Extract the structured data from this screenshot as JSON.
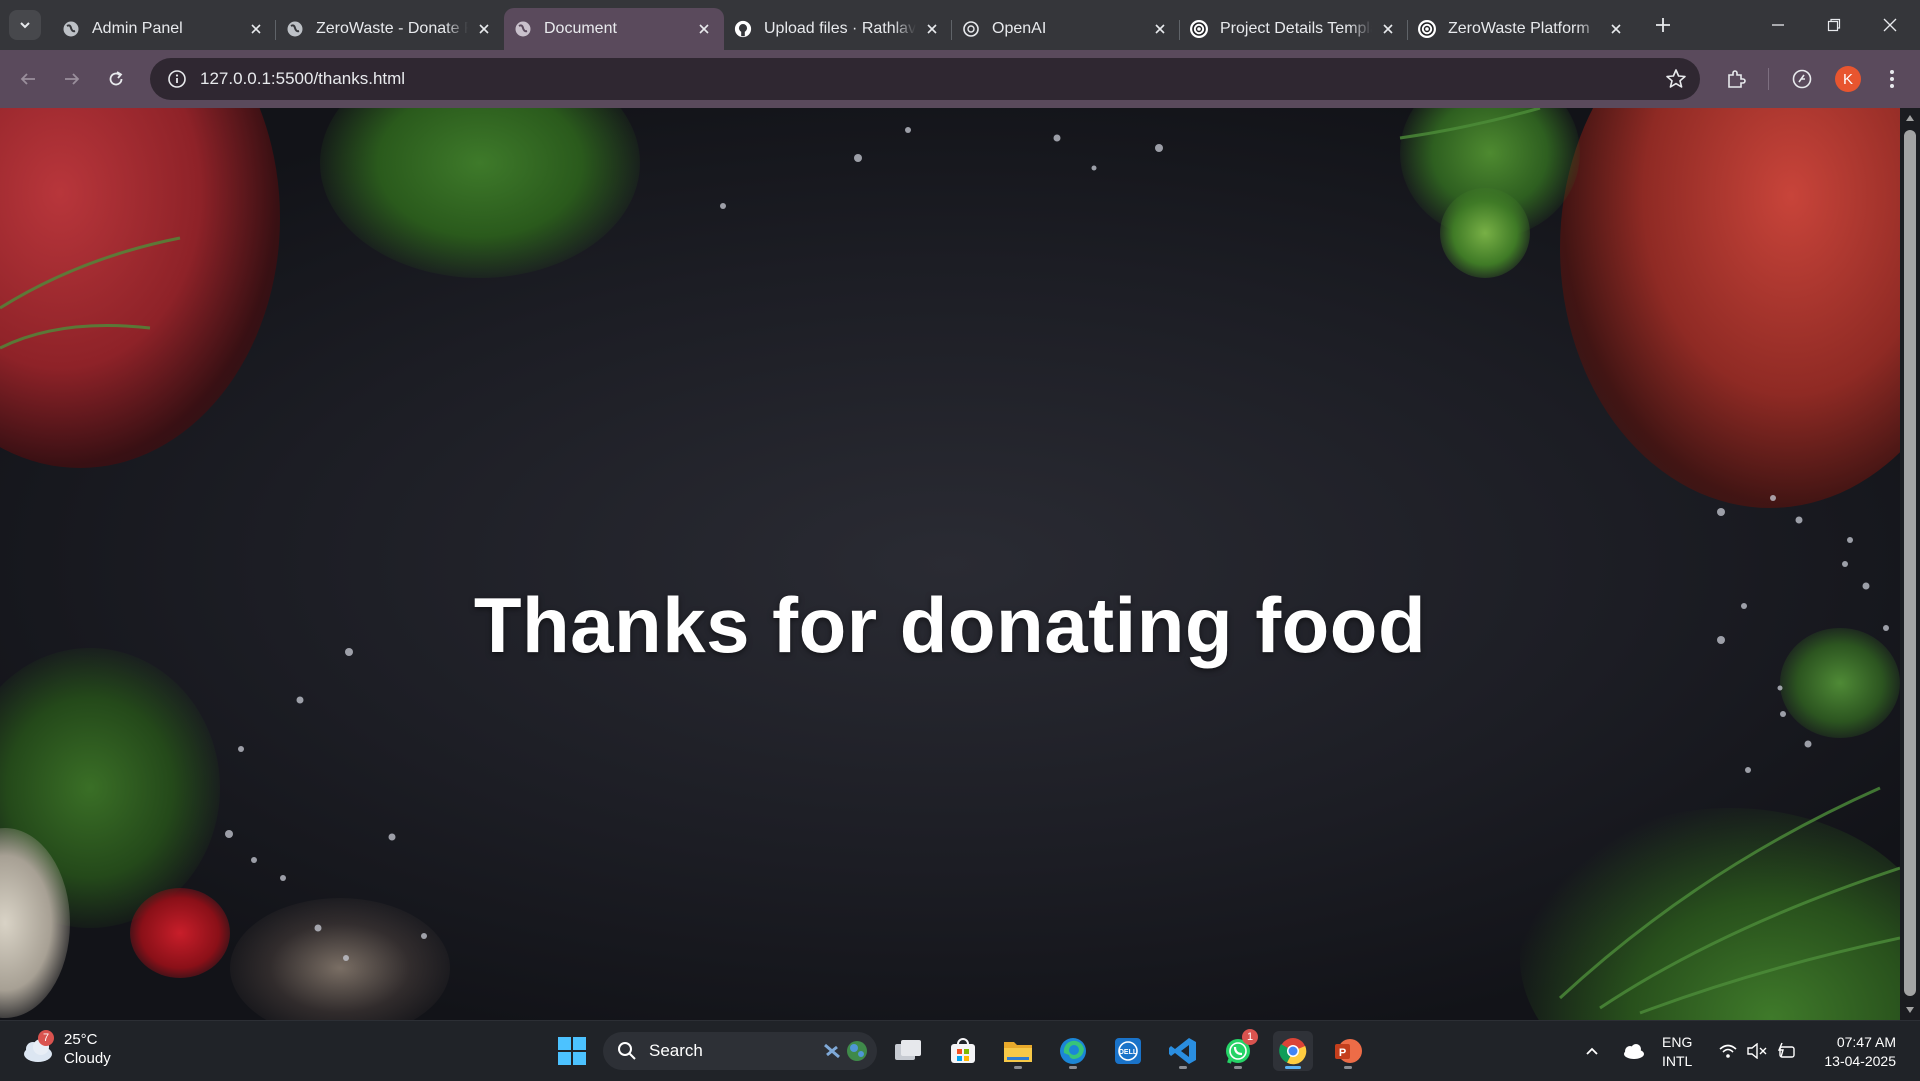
{
  "browser": {
    "tabs": [
      {
        "title": "Admin Panel",
        "favicon": "globe-icon",
        "active": false
      },
      {
        "title": "ZeroWaste - Donate Food",
        "favicon": "globe-icon",
        "active": false
      },
      {
        "title": "Document",
        "favicon": "globe-icon",
        "active": true
      },
      {
        "title": "Upload files · Rathlav",
        "favicon": "github-icon",
        "active": false
      },
      {
        "title": "OpenAI",
        "favicon": "openai-icon",
        "active": false
      },
      {
        "title": "Project Details Template",
        "favicon": "openai-icon",
        "active": false
      },
      {
        "title": "ZeroWaste Platform",
        "favicon": "openai-icon",
        "active": false
      }
    ],
    "url": "127.0.0.1:5500/thanks.html",
    "profile_initial": "K",
    "tab_bg": "#35363a",
    "toolbar_bg": "#5a4a5c"
  },
  "page": {
    "heading": "Thanks for donating food"
  },
  "taskbar": {
    "weather": {
      "temp": "25°C",
      "condition": "Cloudy",
      "badge": "7"
    },
    "search_label": "Search",
    "apps": [
      {
        "name": "task-view-icon"
      },
      {
        "name": "microsoft-store-icon"
      },
      {
        "name": "file-explorer-icon"
      },
      {
        "name": "edge-icon"
      },
      {
        "name": "dell-icon"
      },
      {
        "name": "vscode-icon"
      },
      {
        "name": "whatsapp-icon",
        "badge": "1"
      },
      {
        "name": "chrome-icon"
      },
      {
        "name": "powerpoint-icon"
      }
    ],
    "lang_line1": "ENG",
    "lang_line2": "INTL",
    "time": "07:47 AM",
    "date": "13-04-2025"
  }
}
